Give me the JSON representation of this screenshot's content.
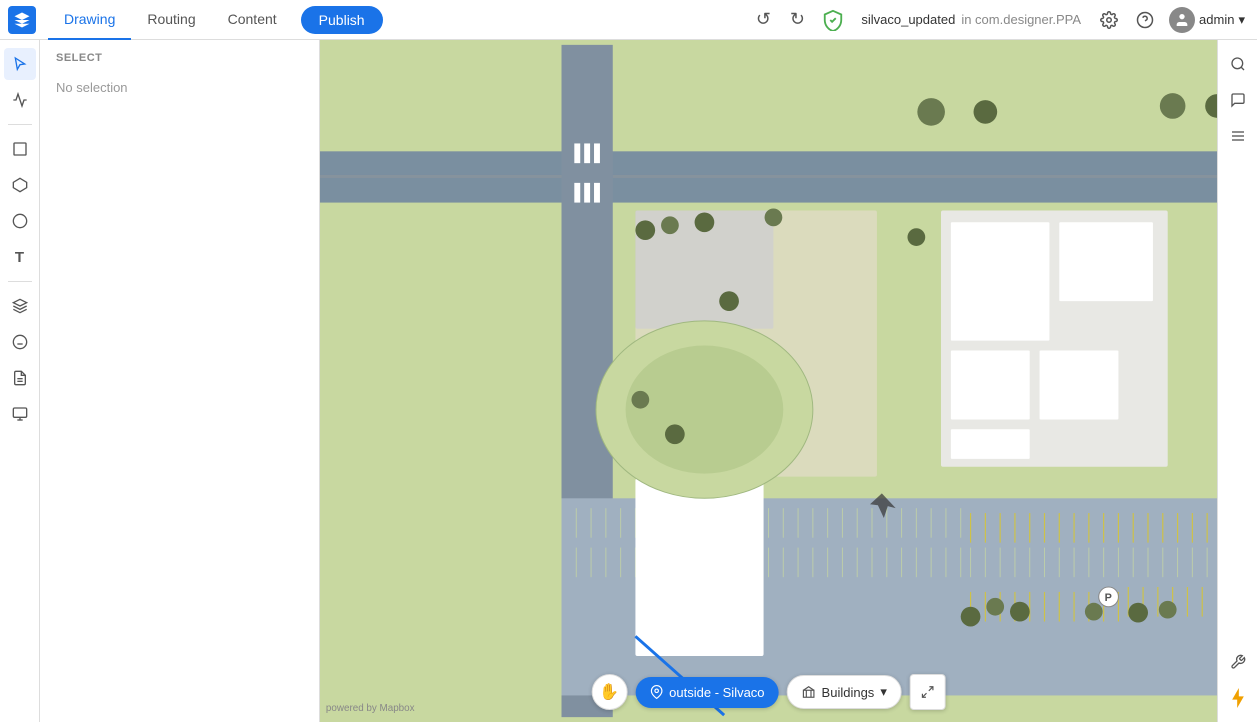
{
  "topbar": {
    "tabs": [
      {
        "id": "drawing",
        "label": "Drawing",
        "active": true
      },
      {
        "id": "routing",
        "label": "Routing",
        "active": false
      },
      {
        "id": "content",
        "label": "Content",
        "active": false
      }
    ],
    "publish_label": "Publish",
    "file_name": "silvaco_updated",
    "file_path": "in com.designer.PPA",
    "user_label": "admin"
  },
  "left_toolbar": {
    "tools": [
      {
        "id": "select",
        "icon": "↖",
        "label": "select-tool",
        "active": true
      },
      {
        "id": "stats",
        "icon": "↗",
        "label": "stats-tool",
        "active": false
      },
      {
        "id": "rect",
        "icon": "□",
        "label": "rectangle-tool",
        "active": false
      },
      {
        "id": "polygon",
        "icon": "⬠",
        "label": "polygon-tool",
        "active": false
      },
      {
        "id": "circle",
        "icon": "○",
        "label": "circle-tool",
        "active": false
      },
      {
        "id": "text",
        "icon": "T",
        "label": "text-tool",
        "active": false
      },
      {
        "id": "layer",
        "icon": "◫",
        "label": "layer-tool",
        "active": false
      },
      {
        "id": "face",
        "icon": "☺",
        "label": "face-tool",
        "active": false
      },
      {
        "id": "doc",
        "icon": "📄",
        "label": "document-tool",
        "active": false
      },
      {
        "id": "stack",
        "icon": "⊞",
        "label": "stack-tool",
        "active": false
      }
    ]
  },
  "side_panel": {
    "header": "SELECT",
    "content": "No selection"
  },
  "right_toolbar": {
    "icons": [
      {
        "id": "search",
        "icon": "🔍",
        "label": "search-icon"
      },
      {
        "id": "comment",
        "icon": "💬",
        "label": "comment-icon"
      },
      {
        "id": "list",
        "icon": "≡",
        "label": "list-icon"
      },
      {
        "id": "wrench",
        "icon": "🔧",
        "label": "settings-icon"
      },
      {
        "id": "bolt",
        "icon": "⚡",
        "label": "bolt-icon"
      }
    ]
  },
  "bottom_bar": {
    "location": "outside - Silvaco",
    "buildings": "Buildings",
    "buildings_has_dropdown": true
  },
  "map": {
    "watermark": "powered by Mapbox"
  }
}
